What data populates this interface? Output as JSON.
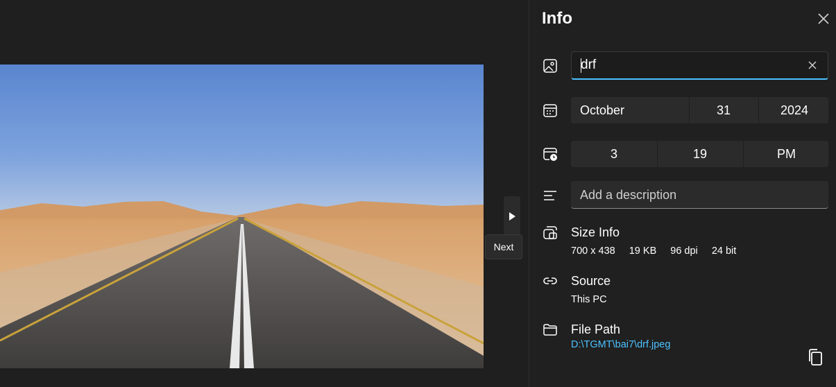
{
  "viewer": {
    "next_tooltip": "Next"
  },
  "info": {
    "title": "Info",
    "name_value": "drf",
    "date": {
      "month": "October",
      "day": "31",
      "year": "2024"
    },
    "time": {
      "hour": "3",
      "minute": "19",
      "ampm": "PM"
    },
    "description_placeholder": "Add a description",
    "size_info": {
      "label": "Size Info",
      "dimensions": "700 x 438",
      "file_size": "19 KB",
      "dpi": "96 dpi",
      "bit_depth": "24 bit"
    },
    "source": {
      "label": "Source",
      "value": "This PC"
    },
    "file_path": {
      "label": "File Path",
      "value": "D:\\TGMT\\bai7\\drf.jpeg"
    }
  },
  "colors": {
    "accent": "#4cc2ff",
    "panel_bg": "#202020",
    "field_bg": "#2b2b2b"
  },
  "icons": [
    "image-icon",
    "calendar-icon",
    "clock-calendar-icon",
    "description-icon",
    "size-info-icon",
    "link-icon",
    "folder-icon",
    "copy-icon",
    "close-icon",
    "clear-icon",
    "play-icon"
  ]
}
